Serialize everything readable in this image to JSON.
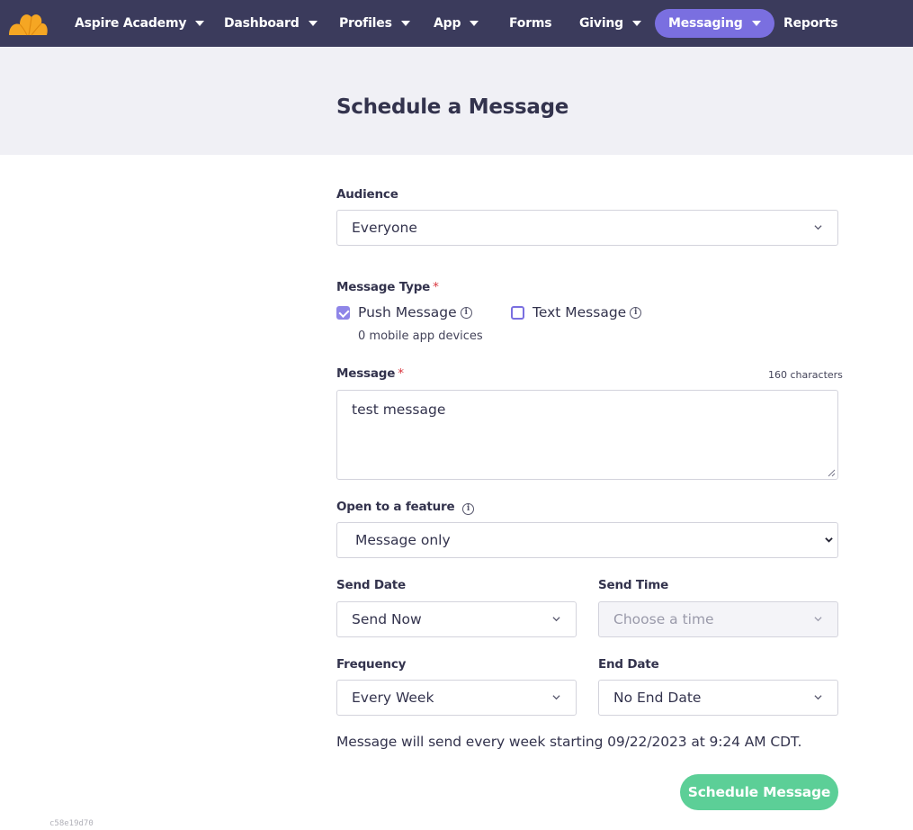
{
  "nav": {
    "brand": "Aspire Academy",
    "items": [
      {
        "label": "Dashboard"
      },
      {
        "label": "Profiles"
      },
      {
        "label": "App"
      },
      {
        "label": "Forms"
      },
      {
        "label": "Giving"
      },
      {
        "label": "Messaging"
      },
      {
        "label": "Reports"
      }
    ],
    "active_color": "#7a6fe0",
    "bg_color": "#3b3b5c"
  },
  "page": {
    "title": "Schedule a Message"
  },
  "form": {
    "audience": {
      "label": "Audience",
      "value": "Everyone"
    },
    "message_type": {
      "label": "Message Type",
      "required_mark": "*",
      "push": {
        "label": "Push Message",
        "checked": true,
        "note": "0 mobile app devices"
      },
      "text": {
        "label": "Text Message",
        "checked": false
      }
    },
    "message": {
      "label": "Message",
      "required_mark": "*",
      "char_count": "160 characters",
      "value": "test message"
    },
    "feature": {
      "label": "Open to a feature",
      "value": "Message only"
    },
    "send_date": {
      "label": "Send Date",
      "value": "Send Now"
    },
    "send_time": {
      "label": "Send Time",
      "placeholder": "Choose a time"
    },
    "frequency": {
      "label": "Frequency",
      "value": "Every Week"
    },
    "end_date": {
      "label": "End Date",
      "value": "No End Date"
    },
    "summary": "Message will send every week starting 09/22/2023 at 9:24 AM CDT.",
    "submit_label": "Schedule Message",
    "submit_color": "#5ccf97"
  },
  "footer": {
    "hash": "c58e19d70"
  }
}
